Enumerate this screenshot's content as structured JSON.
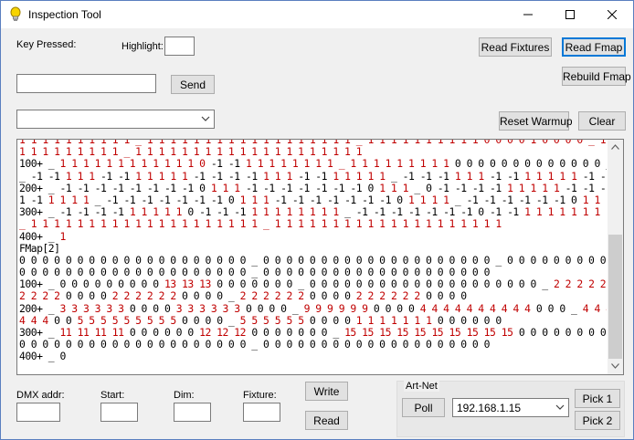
{
  "window": {
    "title": "Inspection Tool",
    "icon": "lightbulb-icon"
  },
  "key_pressed": {
    "label": "Key Pressed:"
  },
  "highlight": {
    "label": "Highlight:",
    "value": ""
  },
  "send": {
    "input_value": "",
    "button": "Send"
  },
  "buttons": {
    "read_fixtures": "Read Fixtures",
    "read_fmap": "Read Fmap",
    "rebuild_fmap": "Rebuild Fmap",
    "reset_warmup": "Reset Warmup",
    "clear": "Clear",
    "write": "Write",
    "read": "Read"
  },
  "top_combo": {
    "value": ""
  },
  "log": {
    "lines": [
      [
        {
          "t": "1 1 1 1 1 1 1 1 1 1 _ 1 1 1 1 1 1 1 1 1 1 1 1 1 1 1 1 1 1 _ 1 1 1 1 1 1 1 1 1 1 0 0 0 0 1 0 0 0 0 _ 1 1 1 1 1 1 1 1 1",
          "r": true
        }
      ],
      [
        {
          "t": "1 1 1 1 1 1 1 1 1 _ 1 1 1 1 1 1 1 1 1 1 1 1 1 1 1 1 1 1 1 1 ",
          "r": true
        }
      ],
      [
        {
          "t": "100+ _ ",
          "r": false
        },
        {
          "t": "1 1 1 1 1 1 1 1 1 1 1 1 0 ",
          "r": true
        },
        {
          "t": "-1 -1 ",
          "r": false
        },
        {
          "t": "1 1 1 1 1 1 1 1 _ 1 1 1 1 1 1 1 1 1 ",
          "r": true
        },
        {
          "t": "0 0 0 0 0 0 0 0 0 0 0 0 0 _ -1 -1 -1 -1 ",
          "r": false
        },
        {
          "t": "1 1 1 ",
          "r": true
        },
        {
          "t": "-1 -1 ",
          "r": false
        },
        {
          "t": "1 1 1 1 1 ",
          "r": true
        },
        {
          "t": "-1 -1 -1 -1 ",
          "r": false
        },
        {
          "t": "1 1 ",
          "r": true
        },
        {
          "t": "-1 -1 ",
          "r": false
        },
        {
          "t": "1 1 1 1 1",
          "r": true
        }
      ],
      [
        {
          "t": "_ -1 -1 ",
          "r": false
        },
        {
          "t": "1 1 1 ",
          "r": true
        },
        {
          "t": "-1 -1 ",
          "r": false
        },
        {
          "t": "1 1 1 1 1 ",
          "r": true
        },
        {
          "t": "-1 -1 -1 -1 ",
          "r": false
        },
        {
          "t": "1 1 1 ",
          "r": true
        },
        {
          "t": "-1 -1 ",
          "r": false
        },
        {
          "t": "1 1 1 1 1 ",
          "r": true
        },
        {
          "t": "_ -1 -1 -1 ",
          "r": false
        },
        {
          "t": "1 1 1 ",
          "r": true
        },
        {
          "t": "-1 -1 ",
          "r": false
        },
        {
          "t": "1 1 1 1 1 ",
          "r": true
        },
        {
          "t": "-1 -1 -1 -1 ",
          "r": false
        },
        {
          "t": "1 1 1 ",
          "r": true
        },
        {
          "t": "-1 -1 ",
          "r": false
        },
        {
          "t": "1 1 1 1 1 ",
          "r": true
        }
      ],
      [
        {
          "t": "200+ _ -1 -1 -1 -1 -1 -1 -1 -1 0 ",
          "r": false
        },
        {
          "t": "1 1 1 ",
          "r": true
        },
        {
          "t": "-1 -1 -1 -1 -1 -1 -1 0 ",
          "r": false
        },
        {
          "t": "1 1 1 ",
          "r": true
        },
        {
          "t": "_ 0 -1 -1 -1 -1 ",
          "r": false
        },
        {
          "t": "1 1 1 1 1 ",
          "r": true
        },
        {
          "t": "-1 -1 -1 -1 -1 -1 -1 0 ",
          "r": false
        },
        {
          "t": "1 1 1 ",
          "r": true
        },
        {
          "t": "_ -1 -1 -1 -1 -1 -1 0 ",
          "r": false
        },
        {
          "t": "1 1 1 ",
          "r": true
        },
        {
          "t": "0 -1 -1 -1 -",
          "r": false
        }
      ],
      [
        {
          "t": "1 -1 ",
          "r": false
        },
        {
          "t": "1 1 1 1 ",
          "r": true
        },
        {
          "t": "_ -1 -1 -1 -1 -1 -1 -1 0 ",
          "r": false
        },
        {
          "t": "1 1 1 ",
          "r": true
        },
        {
          "t": "-1 -1 -1 -1 -1 -1 -1 0 ",
          "r": false
        },
        {
          "t": "1 1 1 1 ",
          "r": true
        },
        {
          "t": "_ -1 -1 -1 -1 -1 -1 0 ",
          "r": false
        },
        {
          "t": "1 1 1 1 ",
          "r": true
        },
        {
          "t": "-1 -1 -1 -1 -1 -1 ",
          "r": false
        },
        {
          "t": "1 1 1 1 1 1",
          "r": true
        }
      ],
      [
        {
          "t": "300+ _ -1 -1 -1 -1 ",
          "r": false
        },
        {
          "t": "1 1 1 1 1 ",
          "r": true
        },
        {
          "t": "0 -1 -1 -1 ",
          "r": false
        },
        {
          "t": "1 1 1 1 1 1 1 1 ",
          "r": true
        },
        {
          "t": "_ -1 -1 -1 -1 -1 -1 -1 0 -1 -1 ",
          "r": false
        },
        {
          "t": "1 1 1 1 1 1 1 1 1 1 ",
          "r": true
        },
        {
          "t": "_ ",
          "r": false
        },
        {
          "t": "1 1 1 1 1 1 1 1 1 1 1 1 1 1 1 1 1 1 1",
          "r": true
        }
      ],
      [
        {
          "t": "_ 1 1 1 1 1 1 1 1 1 1 1 1 1 1 1 1 1 1 1 1 _ 1 1 1 1 1 1 1 1 1 1 1 1 1 1 1 1 1 1 1 1",
          "r": true
        }
      ],
      [
        {
          "t": "400+ _ ",
          "r": false
        },
        {
          "t": "1",
          "r": true
        }
      ],
      [
        {
          "t": "FMap[2]",
          "r": false
        }
      ],
      [
        {
          "t": "0 0 0 0 0 0 0 0 0 0 0 0 0 0 0 0 0 0 0 0 _ 0 0 0 0 0 0 0 0 0 0 0 0 0 0 0 0 0 0 0 0 _ 0 0 0 0 0 0 0 0 0 0 0 0 0 0 0 0 0 0 0 0 _ 0 0 0 0 0 0 0 0 0 0 0 0 0",
          "r": false
        }
      ],
      [
        {
          "t": "0 0 0 0 0 0 0 0 0 0 0 0 0 0 0 0 0 0 0 0 _ 0 0 0 0 0 0 0 0 0 0 0 0 0 0 0 0 0 0 0 0",
          "r": false
        }
      ],
      [
        {
          "t": "100+ _ 0 0 0 0 0 0 0 0 0 ",
          "r": false
        },
        {
          "t": "13 13 13 ",
          "r": true
        },
        {
          "t": "0 0 0 0 0 0 0 _ 0 0 0 0 0 0 0 0 0 0 0 0 0 0 0 0 0 0 0 0 _ ",
          "r": false
        },
        {
          "t": "2 2 2 2 2 2 ",
          "r": true
        },
        {
          "t": "0 0 0 0 ",
          "r": false
        },
        {
          "t": "2 2 2 2 2 2 ",
          "r": true
        },
        {
          "t": "0 0 0 0 _ ",
          "r": false
        },
        {
          "t": "2 2",
          "r": true
        }
      ],
      [
        {
          "t": "2 2 2 2 ",
          "r": true
        },
        {
          "t": "0 0 0 0 ",
          "r": false
        },
        {
          "t": "2 2 2 2 2 2 ",
          "r": true
        },
        {
          "t": "0 0 0 0 _ ",
          "r": false
        },
        {
          "t": "2 2 2 2 2 2 ",
          "r": true
        },
        {
          "t": "0 0 0 0 ",
          "r": false
        },
        {
          "t": "2 2 2 2 2 2 ",
          "r": true
        },
        {
          "t": "0 0 0 0",
          "r": false
        }
      ],
      [
        {
          "t": "200+ _ ",
          "r": false
        },
        {
          "t": "3 3 3 3 3 3 ",
          "r": true
        },
        {
          "t": "0 0 0 0 ",
          "r": false
        },
        {
          "t": "3 3 3 3 3 3 ",
          "r": true
        },
        {
          "t": "0 0 0 0 _ ",
          "r": false
        },
        {
          "t": "9 9 9 9 9 9 ",
          "r": true
        },
        {
          "t": "0 0 0 0 ",
          "r": false
        },
        {
          "t": "4 4 4 4 4 4 4 4 4 4 ",
          "r": true
        },
        {
          "t": "0 0 0 _ ",
          "r": false
        },
        {
          "t": "4 4 4 4 4 4 4 ",
          "r": true
        },
        {
          "t": "0 0 0 ",
          "r": false
        },
        {
          "t": "9 9 9 9 9 9 ",
          "r": true
        },
        {
          "t": "0 0 0 0 _ ",
          "r": false
        },
        {
          "t": "4 4 4 4",
          "r": true
        }
      ],
      [
        {
          "t": "4 4 4 ",
          "r": true
        },
        {
          "t": "0 0 ",
          "r": false
        },
        {
          "t": "5 5 5 5 5 5 5 5 5 ",
          "r": true
        },
        {
          "t": "0 0 0 0 _ ",
          "r": false
        },
        {
          "t": "5 5 5 5 5 5 ",
          "r": true
        },
        {
          "t": "0 0 0 0 ",
          "r": false
        },
        {
          "t": "1 1 1 1 1 1 1 ",
          "r": true
        },
        {
          "t": "0 0 0 0 0 0",
          "r": false
        }
      ],
      [
        {
          "t": "300+ _ ",
          "r": false
        },
        {
          "t": "11 11 11 11 ",
          "r": true
        },
        {
          "t": "0 0 0 0 0 0 ",
          "r": false
        },
        {
          "t": "12 12 12 ",
          "r": true
        },
        {
          "t": "0 0 0 0 0 0 0 _ ",
          "r": false
        },
        {
          "t": "15 15 15 15 15 15 15 15 15 15 ",
          "r": true
        },
        {
          "t": "0 0 0 0 0 0 0 0 0 0 _ 0 0 0 0 0 0 0 0 0 0 0 0 0 0 0 0 0 0",
          "r": false
        }
      ],
      [
        {
          "t": "0 0 0 0 0 0 0 0 0 0 0 0 0 0 0 0 0 0 0 0 _ 0 0 0 0 0 0 0 0 0 0 0 0 0 0 0 0 0 0 0 0",
          "r": false
        }
      ],
      [
        {
          "t": "400+ _ 0",
          "r": false
        }
      ]
    ]
  },
  "bottom": {
    "dmx_label": "DMX addr:",
    "dmx_value": "",
    "start_label": "Start:",
    "start_value": "",
    "dim_label": "Dim:",
    "dim_value": "",
    "fixture_label": "Fixture:",
    "fixture_value": ""
  },
  "artnet": {
    "group_label": "Art-Net",
    "poll": "Poll",
    "ip_value": "192.168.1.15",
    "pick1": "Pick 1",
    "pick2": "Pick 2"
  }
}
